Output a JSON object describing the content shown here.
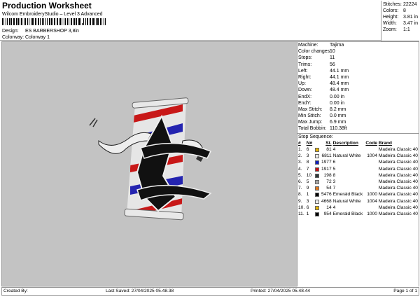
{
  "header": {
    "title": "Production Worksheet",
    "subtitle": "Wilcom EmbroideryStudio – Level 3 Advanced",
    "design_label": "Design:",
    "design_value": "ES BARBERSHOP 3,8in",
    "colorway_label": "Colorway:",
    "colorway_value": "Colorway 1"
  },
  "stats": [
    {
      "label": "Stitches:",
      "value": "22224"
    },
    {
      "label": "Colors:",
      "value": "8"
    },
    {
      "label": "Height:",
      "value": "3.81 in"
    },
    {
      "label": "Width:",
      "value": "3.47 in"
    },
    {
      "label": "Zoom:",
      "value": "1:1"
    }
  ],
  "props": [
    {
      "label": "Machine:",
      "value": "Tajima"
    },
    {
      "label": "Color changes:",
      "value": "10"
    },
    {
      "label": "Stops:",
      "value": "11"
    },
    {
      "label": "Trims:",
      "value": "56"
    },
    {
      "label": "Left:",
      "value": "44.1 mm"
    },
    {
      "label": "Right:",
      "value": "44.1 mm"
    },
    {
      "label": "Up:",
      "value": "48.4 mm"
    },
    {
      "label": "Down:",
      "value": "48.4 mm"
    },
    {
      "label": "EndX:",
      "value": "0.00 in"
    },
    {
      "label": "EndY:",
      "value": "0.00 in"
    },
    {
      "label": "Max Stitch:",
      "value": "8.2 mm"
    },
    {
      "label": "Min Stitch:",
      "value": "0.0 mm"
    },
    {
      "label": "Max Jump:",
      "value": "6.9 mm"
    },
    {
      "label": "Total Bobbin:",
      "value": "110.38ft"
    }
  ],
  "stop_sequence": {
    "title": "Stop Sequence:",
    "headers": [
      "#",
      "N#",
      "St.",
      "Description",
      "Code",
      "Brand"
    ],
    "rows": [
      {
        "n": "1.",
        "needle": "6",
        "color": "#e8b400",
        "st": "81",
        "desc": "4",
        "code": "",
        "brand": "Madeira Classic 40"
      },
      {
        "n": "2.",
        "needle": "3",
        "color": "#ececec",
        "st": "6811",
        "desc": "Natural White",
        "code": "1004",
        "brand": "Madeira Classic 40"
      },
      {
        "n": "3.",
        "needle": "8",
        "color": "#1020c0",
        "st": "1977",
        "desc": "6",
        "code": "",
        "brand": "Madeira Classic 40"
      },
      {
        "n": "4.",
        "needle": "7",
        "color": "#c81010",
        "st": "1917",
        "desc": "5",
        "code": "",
        "brand": "Madeira Classic 40"
      },
      {
        "n": "5.",
        "needle": "10",
        "color": "#303a3a",
        "st": "198",
        "desc": "8",
        "code": "",
        "brand": "Madeira Classic 40"
      },
      {
        "n": "6.",
        "needle": "5",
        "color": "#a8a8a8",
        "st": "72",
        "desc": "3",
        "code": "",
        "brand": "Madeira Classic 40"
      },
      {
        "n": "7.",
        "needle": "9",
        "color": "#e07820",
        "st": "54",
        "desc": "7",
        "code": "",
        "brand": "Madeira Classic 40"
      },
      {
        "n": "8.",
        "needle": "1",
        "color": "#000000",
        "st": "5476",
        "desc": "Emerald Black",
        "code": "1000",
        "brand": "Madeira Classic 40"
      },
      {
        "n": "9.",
        "needle": "3",
        "color": "#ececec",
        "st": "4668",
        "desc": "Natural White",
        "code": "1004",
        "brand": "Madeira Classic 40"
      },
      {
        "n": "10.",
        "needle": "6",
        "color": "#e8b400",
        "st": "14",
        "desc": "4",
        "code": "",
        "brand": "Madeira Classic 40"
      },
      {
        "n": "11.",
        "needle": "1",
        "color": "#000000",
        "st": "954",
        "desc": "Emerald Black",
        "code": "1000",
        "brand": "Madeira Classic 40"
      }
    ]
  },
  "footer": {
    "created": "Created By:",
    "saved": "Last Saved: 27/04/2025 05.48.38",
    "printed": "Printed: 27/04/2025 05.48.44",
    "page": "Page 1 of 1"
  }
}
